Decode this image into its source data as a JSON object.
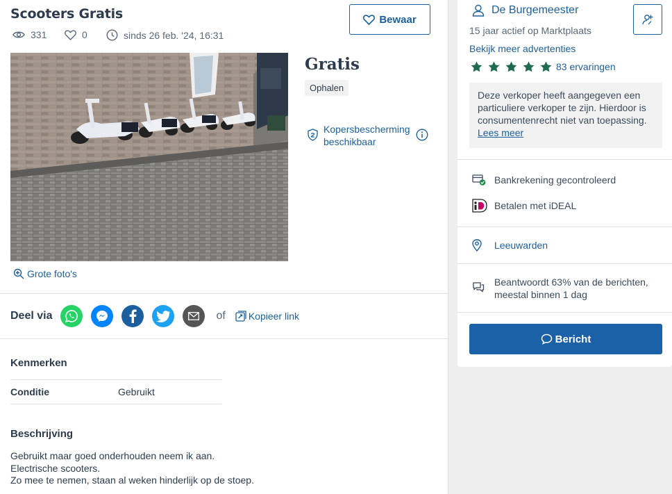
{
  "listing": {
    "title": "Scooters Gratis",
    "views": "331",
    "favorites": "0",
    "since": "sinds 26 feb. '24, 16:31",
    "save_label": "Bewaar",
    "price": "Gratis",
    "delivery": "Ophalen",
    "protection": "Kopersbescherming beschikbaar",
    "big_photos": "Grote foto's"
  },
  "share": {
    "label": "Deel via",
    "networks": [
      "whatsapp",
      "messenger",
      "facebook",
      "twitter",
      "email"
    ],
    "or": "of",
    "copy_link": "Kopieer link"
  },
  "features": {
    "heading": "Kenmerken",
    "rows": [
      {
        "key": "Conditie",
        "value": "Gebruikt"
      }
    ]
  },
  "description": {
    "heading": "Beschrijving",
    "lines": [
      "Gebruikt maar goed onderhouden neem ik aan.",
      "Electrische scooters.",
      "Zo mee te nemen, staan al weken hinderlijk op de stoep."
    ]
  },
  "seller": {
    "name": "De Burgemeester",
    "active": "15 jaar actief op Marktplaats",
    "more_ads": "Bekijk meer advertenties",
    "stars": 5,
    "reviews": "83 ervaringen",
    "notice": "Deze verkoper heeft aangegeven een particuliere verkoper te zijn. Hierdoor is consumentenrecht niet van toepassing.",
    "notice_link": "Lees meer",
    "bank": "Bankrekening gecontroleerd",
    "ideal": "Betalen met iDEAL",
    "location": "Leeuwarden",
    "response_line1": "Beantwoordt 63% van de berichten,",
    "response_line2": "meestal binnen 1 dag",
    "message_button": "Bericht"
  },
  "colors": {
    "brand_blue": "#1b61a8",
    "star_green": "#1f6b52",
    "whatsapp": "#25d366",
    "messenger": "#0084ff",
    "facebook": "#1b5f9e",
    "twitter": "#1da1f2",
    "email": "#555555"
  }
}
